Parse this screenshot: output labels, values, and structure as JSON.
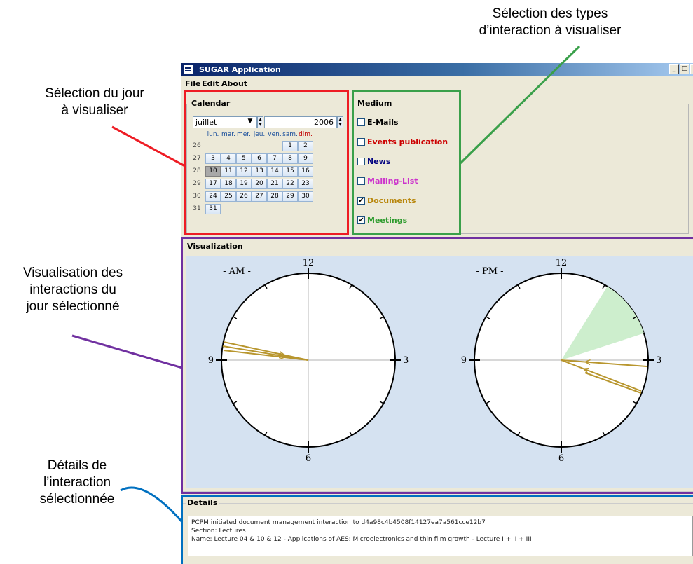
{
  "annotations": {
    "medium_selection": [
      "Sélection des types",
      "d’interaction à visualiser"
    ],
    "day_selection": [
      "Sélection du jour",
      "à visualiser"
    ],
    "visualization": [
      "Visualisation des",
      "interactions du",
      "jour sélectionné"
    ],
    "details": [
      "Détails de",
      "l’interaction",
      "sélectionnée"
    ]
  },
  "window": {
    "title": "SUGAR Application",
    "controls": [
      "_",
      "□",
      "x"
    ]
  },
  "menu": [
    "File",
    "Edit",
    "About"
  ],
  "calendar": {
    "group_title": "Calendar",
    "month": "juillet",
    "year": "2006",
    "weekdays": [
      "lun.",
      "mar.",
      "mer.",
      "jeu.",
      "ven.",
      "sam.",
      "dim."
    ],
    "weeks": [
      {
        "num": "26",
        "days": [
          "",
          "",
          "",
          "",
          "",
          "1",
          "2"
        ]
      },
      {
        "num": "27",
        "days": [
          "3",
          "4",
          "5",
          "6",
          "7",
          "8",
          "9"
        ]
      },
      {
        "num": "28",
        "days": [
          "10",
          "11",
          "12",
          "13",
          "14",
          "15",
          "16"
        ]
      },
      {
        "num": "29",
        "days": [
          "17",
          "18",
          "19",
          "20",
          "21",
          "22",
          "23"
        ]
      },
      {
        "num": "30",
        "days": [
          "24",
          "25",
          "26",
          "27",
          "28",
          "29",
          "30"
        ]
      },
      {
        "num": "31",
        "days": [
          "31",
          "",
          "",
          "",
          "",
          "",
          ""
        ]
      }
    ],
    "selected_day": "10"
  },
  "medium": {
    "group_title": "Medium",
    "items": [
      {
        "label": "E-Mails",
        "checked": false,
        "color": "#000000"
      },
      {
        "label": "Events publication",
        "checked": false,
        "color": "#cc0000"
      },
      {
        "label": "News",
        "checked": false,
        "color": "#000080"
      },
      {
        "label": "Mailing-List",
        "checked": false,
        "color": "#cc33cc"
      },
      {
        "label": "Documents",
        "checked": true,
        "color": "#b8860b"
      },
      {
        "label": "Meetings",
        "checked": true,
        "color": "#2e9b2e"
      }
    ]
  },
  "visualization": {
    "group_title": "Visualization",
    "clocks": [
      {
        "label": "- AM -",
        "numbers": {
          "top": "12",
          "right": "3",
          "bottom": "6",
          "left": "9"
        }
      },
      {
        "label": "- PM -",
        "numbers": {
          "top": "12",
          "right": "3",
          "bottom": "6",
          "left": "9"
        }
      }
    ],
    "colors": {
      "document": "#b8962e",
      "meeting": "#cdeecd",
      "panel_bg": "#d5e2f1"
    }
  },
  "details": {
    "group_title": "Details",
    "lines": [
      "PCPM initiated document management interaction to d4a98c4b4508f14127ea7a561cce12b7",
      "Section: Lectures",
      "Name:  Lecture 04 & 10 & 12 - Applications of AES: Microelectronics and thin film growth - Lecture I + II + III"
    ]
  },
  "highlight_colors": {
    "red": "#ee1c24",
    "green": "#3aa04a",
    "purple": "#7030a0",
    "blue": "#0070c0"
  }
}
